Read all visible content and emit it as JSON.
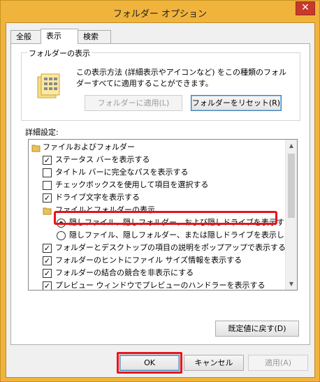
{
  "window": {
    "title": "フォルダー オプション",
    "close_glyph": "✕"
  },
  "tabs": [
    "全般",
    "表示",
    "検索"
  ],
  "folder_view": {
    "legend": "フォルダーの表示",
    "description": "この表示方法 (詳細表示やアイコンなど) をこの種類のフォルダーすべてに適用することができます。",
    "apply_label": "フォルダーに適用(L)",
    "reset_label": "フォルダーをリセット(R)"
  },
  "advanced": {
    "label": "詳細設定:",
    "items": [
      {
        "type": "folder",
        "text": "ファイルおよびフォルダー",
        "level": 0
      },
      {
        "type": "checkbox",
        "text": "ステータス バーを表示する",
        "checked": true,
        "level": 1
      },
      {
        "type": "checkbox",
        "text": "タイトル バーに完全なパスを表示する",
        "checked": false,
        "level": 1
      },
      {
        "type": "checkbox",
        "text": "チェックボックスを使用して項目を選択する",
        "checked": false,
        "level": 1
      },
      {
        "type": "checkbox",
        "text": "ドライブ文字を表示する",
        "checked": true,
        "level": 1
      },
      {
        "type": "folder",
        "text": "ファイルとフォルダーの表示",
        "level": 1
      },
      {
        "type": "radio",
        "text": "隠しファイル、隠しフォルダー、および隠しドライブを表示する",
        "checked": true,
        "level": 2
      },
      {
        "type": "radio",
        "text": "隠しファイル、隠しフォルダー、または隠しドライブを表示しない",
        "checked": false,
        "level": 2
      },
      {
        "type": "checkbox",
        "text": "フォルダーとデスクトップの項目の説明をポップアップで表示する",
        "checked": true,
        "level": 1
      },
      {
        "type": "checkbox",
        "text": "フォルダーのヒントにファイル サイズ情報を表示する",
        "checked": true,
        "level": 1
      },
      {
        "type": "checkbox",
        "text": "フォルダーの結合の競合を非表示にする",
        "checked": true,
        "level": 1
      },
      {
        "type": "checkbox",
        "text": "プレビュー ウィンドウでプレビューのハンドラーを表示する",
        "checked": true,
        "level": 1
      }
    ],
    "defaults_label": "既定値に戻す(D)"
  },
  "footer": {
    "ok": "OK",
    "cancel": "キャンセル",
    "apply": "適用(A)"
  },
  "colors": {
    "frame": "#f0b33c",
    "close": "#c7392b",
    "highlight": "#e8141b"
  }
}
